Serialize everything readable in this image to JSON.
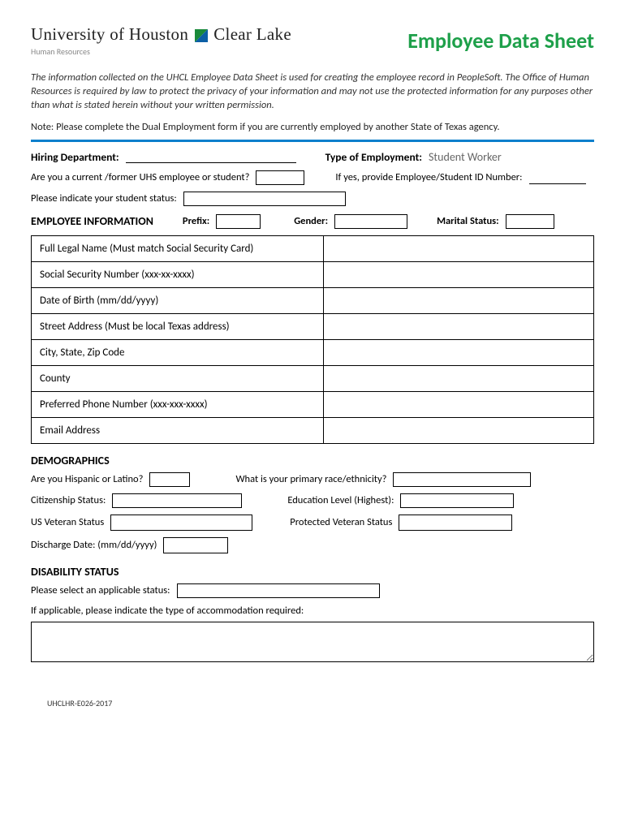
{
  "header": {
    "university_prefix": "University of Houston",
    "university_suffix": "Clear Lake",
    "department": "Human Resources",
    "form_title": "Employee Data Sheet"
  },
  "intro_text": "The information collected on the UHCL Employee Data Sheet is used for creating the employee record in PeopleSoft.  The Office of Human Resources is required by law to protect the privacy of your information and may not use the protected information for any purposes other than what is stated herein without your written permission.",
  "note_text": "Note: Please complete the Dual Employment form if you are currently employed by another State of Texas agency.",
  "hiring": {
    "dept_label": "Hiring Department:",
    "type_label": "Type of Employment:",
    "type_value": "Student Worker"
  },
  "q_uhs": {
    "label": "Are you a current /former UHS employee or student?",
    "id_label": "If yes, provide Employee/Student ID Number:"
  },
  "student_status_label": "Please indicate your student status:",
  "emp_info": {
    "title": "EMPLOYEE INFORMATION",
    "prefix_label": "Prefix:",
    "gender_label": "Gender:",
    "marital_label": "Marital Status:",
    "rows": [
      "Full Legal Name (Must match Social Security Card)",
      "Social Security Number (xxx-xx-xxxx)",
      "Date of Birth (mm/dd/yyyy)",
      "Street Address (Must be local Texas address)",
      "City, State, Zip Code",
      "County",
      "Preferred Phone Number (xxx-xxx-xxxx)",
      "Email Address"
    ]
  },
  "demographics": {
    "title": "DEMOGRAPHICS",
    "hisp_label": "Are you Hispanic or Latino?",
    "race_label": "What is your primary race/ethnicity?",
    "citizenship_label": "Citizenship Status:",
    "education_label": "Education Level (Highest):",
    "veteran_label": "US Veteran Status",
    "protected_label": "Protected Veteran Status",
    "discharge_label": "Discharge Date: (mm/dd/yyyy)"
  },
  "disability": {
    "title": "DISABILITY STATUS",
    "select_label": "Please select an applicable status:",
    "accom_label": "If applicable, please indicate the type of accommodation required:"
  },
  "footer_code": "UHCLHR-E026-2017"
}
